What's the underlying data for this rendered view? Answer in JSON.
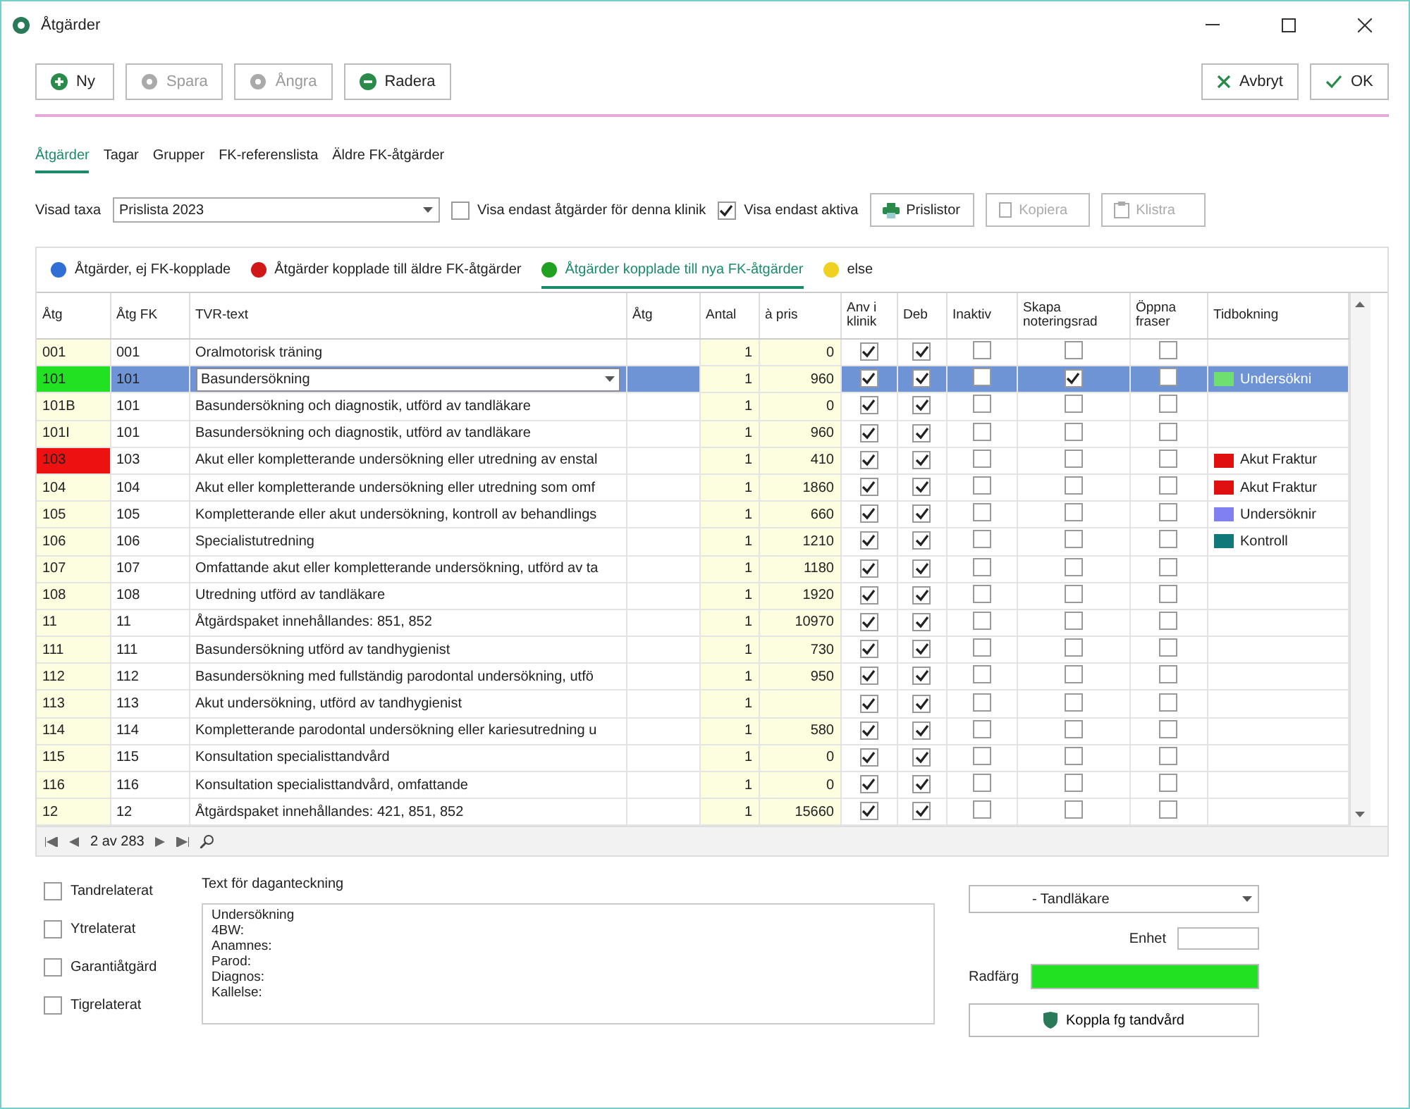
{
  "window": {
    "title": "Åtgärder"
  },
  "toolbar": {
    "left": [
      {
        "label": "Ny",
        "kind": "add",
        "disabled": false
      },
      {
        "label": "Spara",
        "kind": "save",
        "disabled": true
      },
      {
        "label": "Ångra",
        "kind": "undo",
        "disabled": true
      },
      {
        "label": "Radera",
        "kind": "delete",
        "disabled": false
      }
    ],
    "right": [
      {
        "label": "Avbryt",
        "kind": "cancel",
        "disabled": false
      },
      {
        "label": "OK",
        "kind": "ok",
        "disabled": false
      }
    ]
  },
  "tabs": [
    {
      "label": "Åtgärder",
      "selected": true
    },
    {
      "label": "Tagar",
      "selected": false
    },
    {
      "label": "Grupper",
      "selected": false
    },
    {
      "label": "FK-referenslista",
      "selected": false
    },
    {
      "label": "Äldre FK-åtgärder",
      "selected": false
    }
  ],
  "filter": {
    "label": "Visad taxa",
    "value": "Prislista 2023",
    "checks": [
      {
        "label": "Visa endast åtgärder för denna klinik",
        "checked": false
      },
      {
        "label": "Visa endast aktiva",
        "checked": true
      }
    ],
    "buttons": [
      {
        "label": "Prislistor",
        "kind": "print",
        "disabled": false
      },
      {
        "label": "Kopiera",
        "kind": "copy",
        "disabled": true
      },
      {
        "label": "Klistra",
        "kind": "paste",
        "disabled": true
      }
    ]
  },
  "subtabs": [
    {
      "label": "Åtgärder, ej FK-kopplade",
      "color": "#2f6fd6",
      "selected": false
    },
    {
      "label": "Åtgärder kopplade till äldre FK-åtgärder",
      "color": "#d01818",
      "selected": false
    },
    {
      "label": "Åtgärder kopplade till nya FK-åtgärder",
      "color": "#22a022",
      "selected": true
    },
    {
      "label": "else",
      "color": "#f0d020",
      "selected": false
    }
  ],
  "table": {
    "columns": [
      "Åtg",
      "Åtg FK",
      "TVR-text",
      "Åtg",
      "Antal",
      "à pris",
      "Anv i klinik",
      "Deb",
      "Inaktiv",
      "Skapa noteringsrad",
      "Öppna fraser",
      "Tidbokning"
    ],
    "rows": [
      {
        "code": "001",
        "fk": "001",
        "text": "Oralmotorisk träning",
        "count": "1",
        "price": "0",
        "in_clinic": true,
        "deb": true,
        "inactive": false,
        "note_row": false,
        "phrases": false,
        "selected": false
      },
      {
        "code": "101",
        "fk": "101",
        "text": "Basundersökning",
        "count": "1",
        "price": "960",
        "in_clinic": true,
        "deb": true,
        "inactive": false,
        "note_row": true,
        "phrases": false,
        "selected": true,
        "color": "#22e022",
        "booking": {
          "label": "Undersökni",
          "color": "#6fe06f"
        }
      },
      {
        "code": "101B",
        "fk": "101",
        "text": "Basundersökning och diagnostik, utförd av tandläkare",
        "count": "1",
        "price": "0",
        "in_clinic": true,
        "deb": true,
        "inactive": false,
        "note_row": false,
        "phrases": false,
        "selected": false
      },
      {
        "code": "101I",
        "fk": "101",
        "text": "Basundersökning och diagnostik, utförd av tandläkare",
        "count": "1",
        "price": "960",
        "in_clinic": true,
        "deb": true,
        "inactive": false,
        "note_row": false,
        "phrases": false,
        "selected": false
      },
      {
        "code": "103",
        "fk": "103",
        "text": "Akut eller kompletterande undersökning eller utredning av enstal",
        "count": "1",
        "price": "410",
        "in_clinic": true,
        "deb": true,
        "inactive": false,
        "note_row": false,
        "phrases": false,
        "selected": false,
        "color": "#ee1111",
        "booking": {
          "label": "Akut Fraktur",
          "color": "#e01010"
        }
      },
      {
        "code": "104",
        "fk": "104",
        "text": "Akut eller kompletterande undersökning eller utredning som omf",
        "count": "1",
        "price": "1860",
        "in_clinic": true,
        "deb": true,
        "inactive": false,
        "note_row": false,
        "phrases": false,
        "selected": false,
        "booking": {
          "label": "Akut Fraktur",
          "color": "#e01010"
        }
      },
      {
        "code": "105",
        "fk": "105",
        "text": "Kompletterande eller akut undersökning, kontroll av behandlings",
        "count": "1",
        "price": "660",
        "in_clinic": true,
        "deb": true,
        "inactive": false,
        "note_row": false,
        "phrases": false,
        "selected": false,
        "booking": {
          "label": "Undersöknir",
          "color": "#8080f0"
        }
      },
      {
        "code": "106",
        "fk": "106",
        "text": "Specialistutredning",
        "count": "1",
        "price": "1210",
        "in_clinic": true,
        "deb": true,
        "inactive": false,
        "note_row": false,
        "phrases": false,
        "selected": false,
        "booking": {
          "label": "Kontroll",
          "color": "#107878"
        }
      },
      {
        "code": "107",
        "fk": "107",
        "text": "Omfattande akut eller kompletterande undersökning, utförd av ta",
        "count": "1",
        "price": "1180",
        "in_clinic": true,
        "deb": true,
        "inactive": false,
        "note_row": false,
        "phrases": false,
        "selected": false
      },
      {
        "code": "108",
        "fk": "108",
        "text": "Utredning utförd av tandläkare",
        "count": "1",
        "price": "1920",
        "in_clinic": true,
        "deb": true,
        "inactive": false,
        "note_row": false,
        "phrases": false,
        "selected": false
      },
      {
        "code": "11",
        "fk": "11",
        "text": "Åtgärdspaket innehållandes: 851, 852",
        "count": "1",
        "price": "10970",
        "in_clinic": true,
        "deb": true,
        "inactive": false,
        "note_row": false,
        "phrases": false,
        "selected": false
      },
      {
        "code": "111",
        "fk": "111",
        "text": "Basundersökning utförd av tandhygienist",
        "count": "1",
        "price": "730",
        "in_clinic": true,
        "deb": true,
        "inactive": false,
        "note_row": false,
        "phrases": false,
        "selected": false
      },
      {
        "code": "112",
        "fk": "112",
        "text": "Basundersökning med fullständig parodontal undersökning, utfö",
        "count": "1",
        "price": "950",
        "in_clinic": true,
        "deb": true,
        "inactive": false,
        "note_row": false,
        "phrases": false,
        "selected": false
      },
      {
        "code": "113",
        "fk": "113",
        "text": "Akut undersökning, utförd av tandhygienist",
        "count": "1",
        "in_clinic": true,
        "deb": true,
        "inactive": false,
        "note_row": false,
        "phrases": false,
        "selected": false
      },
      {
        "code": "114",
        "fk": "114",
        "text": "Kompletterande parodontal undersökning eller kariesutredning u",
        "count": "1",
        "price": "580",
        "in_clinic": true,
        "deb": true,
        "inactive": false,
        "note_row": false,
        "phrases": false,
        "selected": false
      },
      {
        "code": "115",
        "fk": "115",
        "text": "Konsultation specialisttandvård",
        "count": "1",
        "price": "0",
        "in_clinic": true,
        "deb": true,
        "inactive": false,
        "note_row": false,
        "phrases": false,
        "selected": false
      },
      {
        "code": "116",
        "fk": "116",
        "text": "Konsultation specialisttandvård, omfattande",
        "count": "1",
        "price": "0",
        "in_clinic": true,
        "deb": true,
        "inactive": false,
        "note_row": false,
        "phrases": false,
        "selected": false
      },
      {
        "code": "12",
        "fk": "12",
        "text": "Åtgärdspaket innehållandes: 421, 851, 852",
        "count": "1",
        "price": "15660",
        "in_clinic": true,
        "deb": true,
        "inactive": false,
        "note_row": false,
        "phrases": false,
        "selected": false
      }
    ]
  },
  "pager": {
    "position": "2 av 283"
  },
  "flags": [
    {
      "label": "Tandrelaterat",
      "checked": false
    },
    {
      "label": "Ytrelaterat",
      "checked": false
    },
    {
      "label": "Garantiåtgärd",
      "checked": false
    },
    {
      "label": "Tigrelaterat",
      "checked": false
    }
  ],
  "note": {
    "label": "Text för daganteckning",
    "lines": [
      "Undersökning",
      "4BW:",
      "Anamnes:",
      "Parod:",
      "Diagnos:",
      "Kallelse:"
    ]
  },
  "details": {
    "category": "- Tandläkare",
    "unit_label": "Enhet",
    "row_color_label": "Radfärg",
    "color": "#22e022",
    "link_button": "Koppla fg tandvård"
  }
}
